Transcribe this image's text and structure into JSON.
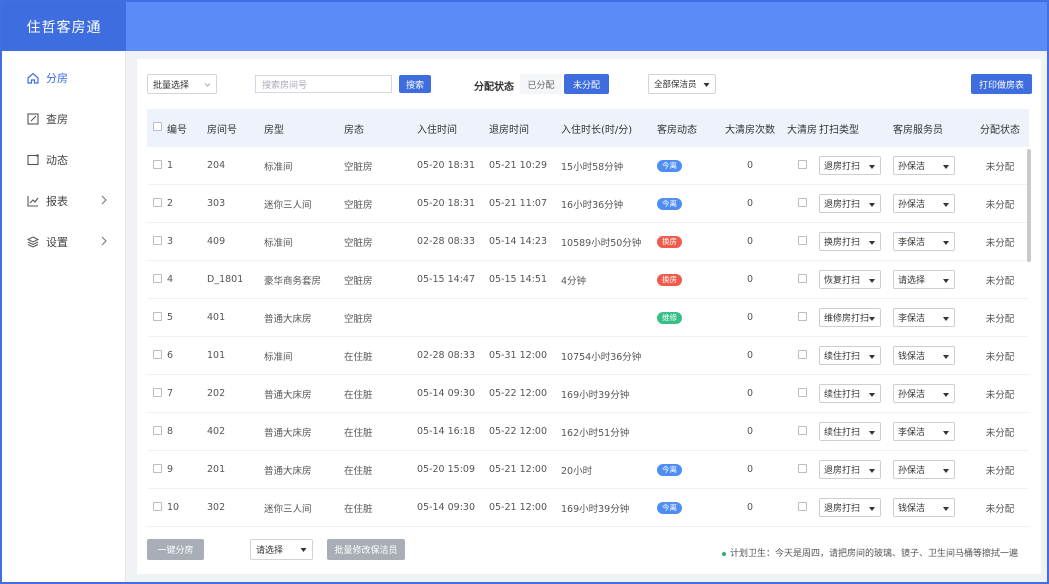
{
  "app": {
    "title": "住哲客房通"
  },
  "colors": {
    "primary": "#3e6de0",
    "header": "#5b8bf7",
    "tag_blue": "#4e8df5",
    "tag_red": "#f05a4a",
    "tag_green": "#36c087"
  },
  "sidebar": {
    "items": [
      {
        "label": "分房",
        "icon": "home-icon",
        "active": true
      },
      {
        "label": "查房",
        "icon": "edit-icon"
      },
      {
        "label": "动态",
        "icon": "message-icon"
      },
      {
        "label": "报表",
        "icon": "chart-icon",
        "has_children": true
      },
      {
        "label": "设置",
        "icon": "layers-icon",
        "has_children": true
      }
    ]
  },
  "toolbar": {
    "batch_select": "批量选择",
    "search_placeholder": "搜索房间号",
    "search_button": "搜索",
    "assign_status_label": "分配状态",
    "seg_assigned": "已分配",
    "seg_unassigned": "未分配",
    "cleaner_select": "全部保洁员",
    "print_button": "打印做房表"
  },
  "table": {
    "headers": [
      "编号",
      "房间号",
      "房型",
      "房态",
      "入住时间",
      "退房时间",
      "入住时长(时/分)",
      "客房动态",
      "大清房次数",
      "大清房",
      "打扫类型",
      "客房服务员",
      "分配状态"
    ],
    "rows": [
      {
        "no": "1",
        "room": "204",
        "type": "标准间",
        "state": "空脏房",
        "in": "05-20 18:31",
        "out": "05-21 10:29",
        "dur": "15小时58分钟",
        "tag": "今离",
        "tag_color": "blue",
        "clean": "0",
        "ptype": "退房打扫",
        "svc": "孙保洁",
        "asg": "未分配"
      },
      {
        "no": "2",
        "room": "303",
        "type": "迷你三人间",
        "state": "空脏房",
        "in": "05-20 18:31",
        "out": "05-21 11:07",
        "dur": "16小时36分钟",
        "tag": "今离",
        "tag_color": "blue",
        "clean": "0",
        "ptype": "退房打扫",
        "svc": "孙保洁",
        "asg": "未分配"
      },
      {
        "no": "3",
        "room": "409",
        "type": "标准间",
        "state": "空脏房",
        "in": "02-28 08:33",
        "out": "05-14 14:23",
        "dur": "10589小时50分钟",
        "tag": "换房",
        "tag_color": "red",
        "clean": "0",
        "ptype": "换房打扫",
        "svc": "李保洁",
        "asg": "未分配"
      },
      {
        "no": "4",
        "room": "D_1801",
        "type": "豪华商务套房",
        "state": "空脏房",
        "in": "05-15 14:47",
        "out": "05-15 14:51",
        "dur": "4分钟",
        "tag": "换房",
        "tag_color": "red",
        "clean": "0",
        "ptype": "恢复打扫",
        "svc": "请选择",
        "asg": "未分配"
      },
      {
        "no": "5",
        "room": "401",
        "type": "普通大床房",
        "state": "空脏房",
        "in": "",
        "out": "",
        "dur": "",
        "tag": "维修",
        "tag_color": "green",
        "clean": "0",
        "ptype": "维修房打扫",
        "svc": "李保洁",
        "asg": "未分配"
      },
      {
        "no": "6",
        "room": "101",
        "type": "标准间",
        "state": "在住脏",
        "in": "02-28 08:33",
        "out": "05-31 12:00",
        "dur": "10754小时36分钟",
        "tag": "",
        "tag_color": "",
        "clean": "0",
        "ptype": "续住打扫",
        "svc": "钱保洁",
        "asg": "未分配"
      },
      {
        "no": "7",
        "room": "202",
        "type": "普通大床房",
        "state": "在住脏",
        "in": "05-14 09:30",
        "out": "05-22 12:00",
        "dur": "169小时39分钟",
        "tag": "",
        "tag_color": "",
        "clean": "0",
        "ptype": "续住打扫",
        "svc": "孙保洁",
        "asg": "未分配"
      },
      {
        "no": "8",
        "room": "402",
        "type": "普通大床房",
        "state": "在住脏",
        "in": "05-14 16:18",
        "out": "05-22 12:00",
        "dur": "162小时51分钟",
        "tag": "",
        "tag_color": "",
        "clean": "0",
        "ptype": "续住打扫",
        "svc": "李保洁",
        "asg": "未分配"
      },
      {
        "no": "9",
        "room": "201",
        "type": "普通大床房",
        "state": "在住脏",
        "in": "05-20 15:09",
        "out": "05-21 12:00",
        "dur": "20小时",
        "tag": "今离",
        "tag_color": "blue",
        "clean": "0",
        "ptype": "退房打扫",
        "svc": "孙保洁",
        "asg": "未分配"
      },
      {
        "no": "10",
        "room": "302",
        "type": "迷你三人间",
        "state": "在住脏",
        "in": "05-14 09:30",
        "out": "05-21 12:00",
        "dur": "169小时39分钟",
        "tag": "今离",
        "tag_color": "blue",
        "clean": "0",
        "ptype": "退房打扫",
        "svc": "钱保洁",
        "asg": "未分配"
      }
    ]
  },
  "footer": {
    "one_key_assign": "一键分房",
    "select_placeholder": "请选择",
    "batch_modify": "批量修改保洁员",
    "hint": "计划卫生：今天是周四，请把房间的玻璃、镜子、卫生间马桶等擦拭一遍"
  }
}
